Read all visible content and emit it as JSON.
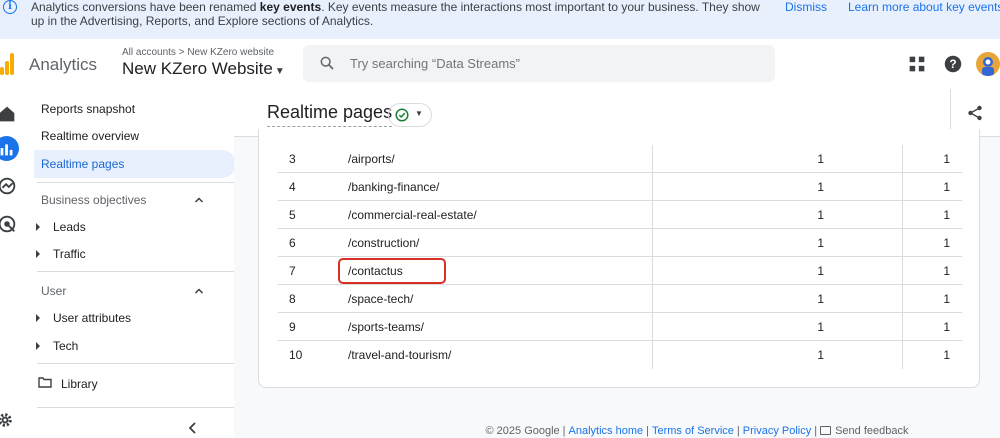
{
  "banner": {
    "text_pre": "Analytics conversions have been renamed ",
    "text_bold": "key events",
    "text_post": ". Key events measure the interactions most important to your business. They show up in the Advertising, Reports, and Explore sections of Analytics.",
    "dismiss_label": "Dismiss",
    "learn_label": "Learn more about key events"
  },
  "header": {
    "app_name": "Analytics",
    "crumb_account": "All accounts",
    "crumb_sep": ">",
    "crumb_property": "New KZero website",
    "property_name": "New KZero Website",
    "search_placeholder": "Try searching “Data Streams”"
  },
  "sidebar": {
    "items": [
      {
        "label": "Reports snapshot"
      },
      {
        "label": "Realtime overview"
      },
      {
        "label": "Realtime pages"
      }
    ],
    "sections": [
      {
        "title": "Business objectives",
        "children": [
          {
            "label": "Leads"
          },
          {
            "label": "Traffic"
          }
        ]
      },
      {
        "title": "User",
        "children": [
          {
            "label": "User attributes"
          },
          {
            "label": "Tech"
          }
        ]
      }
    ],
    "library_label": "Library"
  },
  "main": {
    "title": "Realtime pages",
    "rows": [
      {
        "index": "3",
        "path": "/airports/",
        "v1": "1",
        "v2": "1"
      },
      {
        "index": "4",
        "path": "/banking-finance/",
        "v1": "1",
        "v2": "1"
      },
      {
        "index": "5",
        "path": "/commercial-real-estate/",
        "v1": "1",
        "v2": "1"
      },
      {
        "index": "6",
        "path": "/construction/",
        "v1": "1",
        "v2": "1"
      },
      {
        "index": "7",
        "path": "/contactus",
        "v1": "1",
        "v2": "1"
      },
      {
        "index": "8",
        "path": "/space-tech/",
        "v1": "1",
        "v2": "1"
      },
      {
        "index": "9",
        "path": "/sports-teams/",
        "v1": "1",
        "v2": "1"
      },
      {
        "index": "10",
        "path": "/travel-and-tourism/",
        "v1": "1",
        "v2": "1"
      }
    ]
  },
  "footer": {
    "copyright": "© 2025 Google",
    "links": [
      "Analytics home",
      "Terms of Service",
      "Privacy Policy"
    ],
    "feedback": "Send feedback"
  },
  "colors": {
    "accent": "#1a73e8",
    "highlight": "#d93025",
    "logo": "#f9ab00"
  },
  "icons": [
    "info-icon",
    "search-icon",
    "apps-grid-icon",
    "help-icon",
    "home-icon",
    "reports-icon",
    "explore-icon",
    "advertising-icon",
    "settings-icon",
    "check-circle-icon",
    "share-icon",
    "folder-icon",
    "chevron-left-icon",
    "feedback-icon"
  ]
}
